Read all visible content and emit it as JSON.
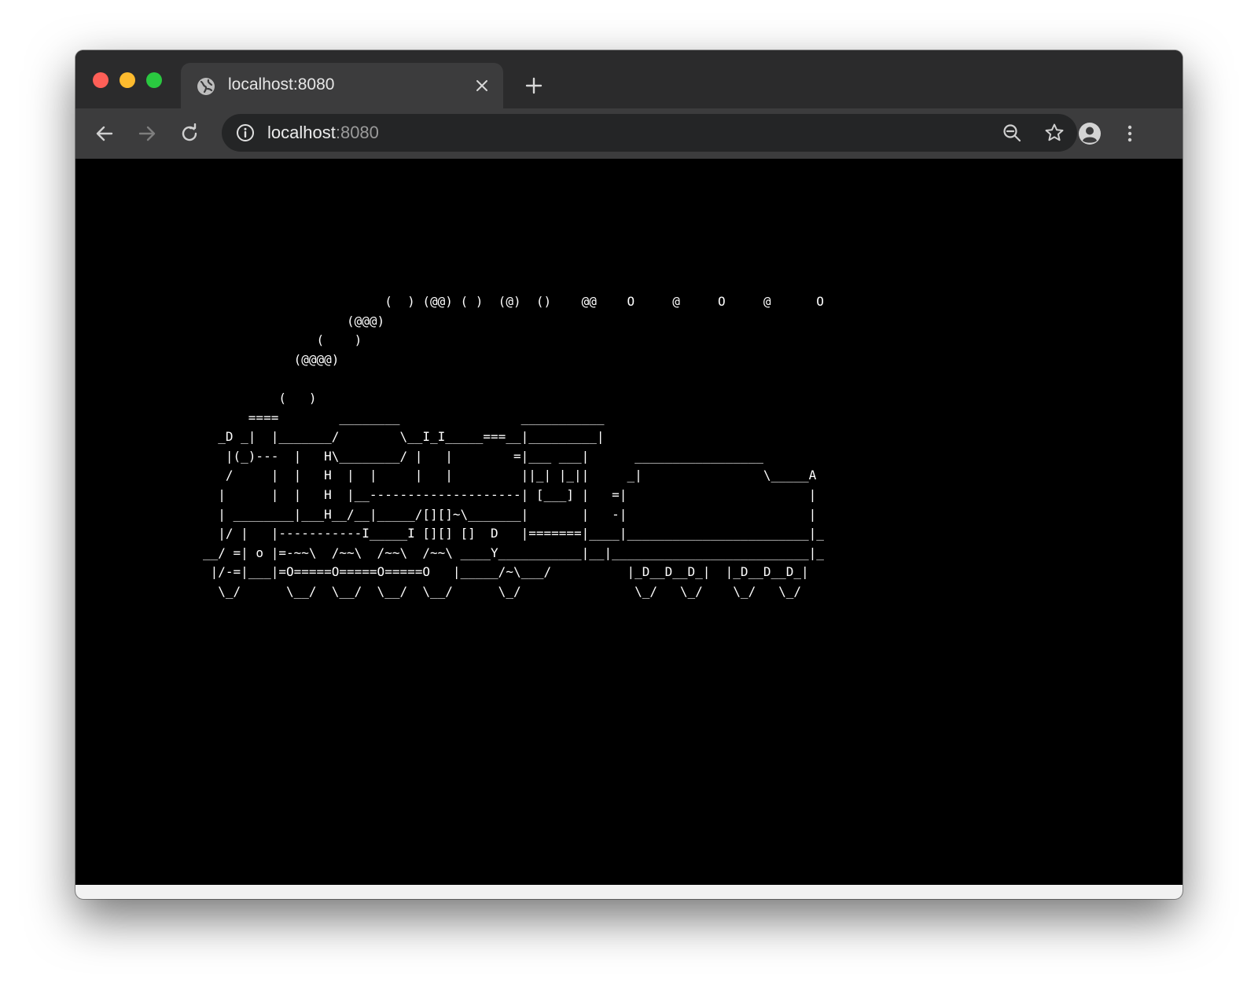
{
  "browser": {
    "tab": {
      "title": "localhost:8080"
    },
    "address": {
      "host": "localhost",
      "port": ":8080"
    },
    "icons": {
      "tab": "globe-icon",
      "close": "close-icon",
      "new_tab": "plus-icon",
      "back": "back-arrow-icon",
      "forward": "forward-arrow-icon",
      "reload": "reload-icon",
      "site_info": "info-icon",
      "zoom": "zoom-out-icon",
      "bookmark": "star-icon",
      "profile": "account-icon",
      "menu": "kebab-menu-icon"
    }
  },
  "page": {
    "background": "#000000",
    "text_color": "#ffffff",
    "ascii_art": "                        (  ) (@@) ( )  (@)  ()    @@    O     @     O     @      O\n                   (@@@)\n               (    )\n            (@@@@)\n\n          (   )\n      ====        ________                ___________\n  _D _|  |_______/        \\__I_I_____===__|_________|\n   |(_)---  |   H\\________/ |   |        =|___ ___|      _________________\n   /     |  |   H  |  |     |   |         ||_| |_||     _|                \\_____A\n  |      |  |   H  |__--------------------| [___] |   =|                        |\n  | ________|___H__/__|_____/[][]~\\_______|       |   -|                        |\n  |/ |   |-----------I_____I [][] []  D   |=======|____|________________________|_\n__/ =| o |=-~~\\  /~~\\  /~~\\  /~~\\ ____Y___________|__|__________________________|_\n |/-=|___|=O=====O=====O=====O   |_____/~\\___/          |_D__D__D_|  |_D__D__D_|\n  \\_/      \\__/  \\__/  \\__/  \\__/      \\_/               \\_/   \\_/    \\_/   \\_/"
  }
}
